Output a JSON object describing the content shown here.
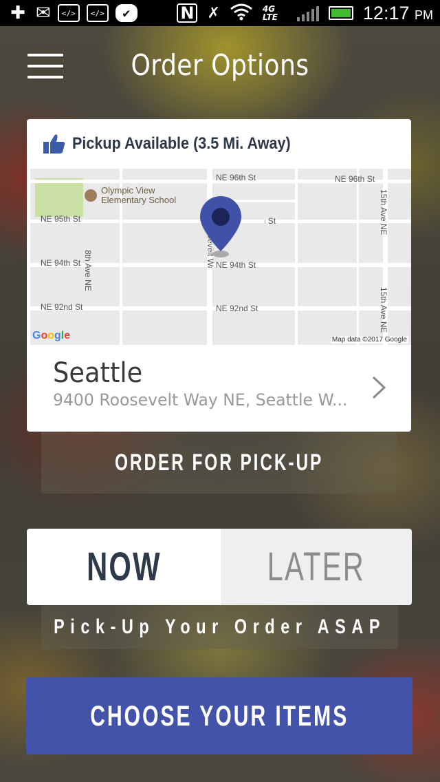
{
  "status_bar": {
    "icons": [
      "add-icon",
      "mail-icon",
      "code-icon",
      "code-icon",
      "checkmark-icon",
      "nfc-icon",
      "mute-icon",
      "wifi-icon",
      "signal-icon",
      "battery-icon"
    ],
    "network": "4G LTE",
    "time": "12:17",
    "ampm": "PM",
    "battery_color": "#3fbf2f"
  },
  "header": {
    "title": "Order Options",
    "menu_icon": "hamburger-menu-icon"
  },
  "location_card": {
    "pickup_label": "Pickup Available (3.5 Mi. Away)",
    "map": {
      "streets": [
        "NE 96th St",
        "NE 96th St",
        "NE 95th St",
        "NE 95th St",
        "NE 94th St",
        "NE 94th St",
        "NE 92nd St",
        "NE 92nd St",
        "8th Ave NE",
        "Roosevelt Way NE",
        "15th Ave NE",
        "15th Ave NE"
      ],
      "place": "Olympic View Elementary School",
      "place_line1": "Olympic View",
      "place_line2": "Elementary School",
      "attribution": "Map data ©2017 Google",
      "logo": "Google"
    },
    "location_name": "Seattle",
    "address": "9400 Roosevelt  Way NE, Seattle W..."
  },
  "order_pickup_label": "ORDER FOR PICK-UP",
  "timing_toggle": {
    "now_label": "NOW",
    "later_label": "LATER",
    "selected": "NOW"
  },
  "asap_label": "Pick-Up Your Order ASAP",
  "cta": {
    "label": "CHOOSE YOUR ITEMS",
    "color": "#4353a9"
  }
}
